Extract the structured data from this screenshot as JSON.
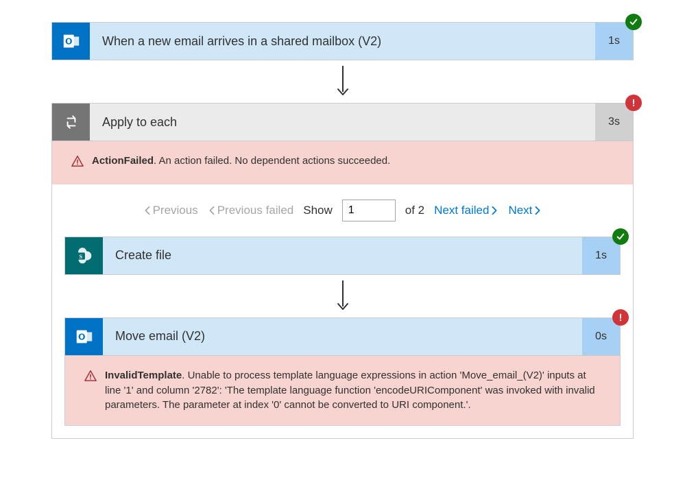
{
  "trigger": {
    "title": "When a new email arrives in a shared mailbox (V2)",
    "duration": "1s"
  },
  "loop": {
    "title": "Apply to each",
    "duration": "3s",
    "error": {
      "code": "ActionFailed",
      "message": ". An action failed. No dependent actions succeeded."
    },
    "pager": {
      "previous": "Previous",
      "previous_failed": "Previous failed",
      "show_label": "Show",
      "current": "1",
      "of_label": "of 2",
      "next_failed": "Next failed",
      "next": "Next"
    }
  },
  "create_file": {
    "title": "Create file",
    "duration": "1s"
  },
  "move_email": {
    "title": "Move email (V2)",
    "duration": "0s",
    "error": {
      "code": "InvalidTemplate",
      "message": ". Unable to process template language expressions in action 'Move_email_(V2)' inputs at line '1' and column '2782': 'The template language function 'encodeURIComponent' was invoked with invalid parameters. The parameter at index '0' cannot be converted to URI component.'."
    }
  }
}
